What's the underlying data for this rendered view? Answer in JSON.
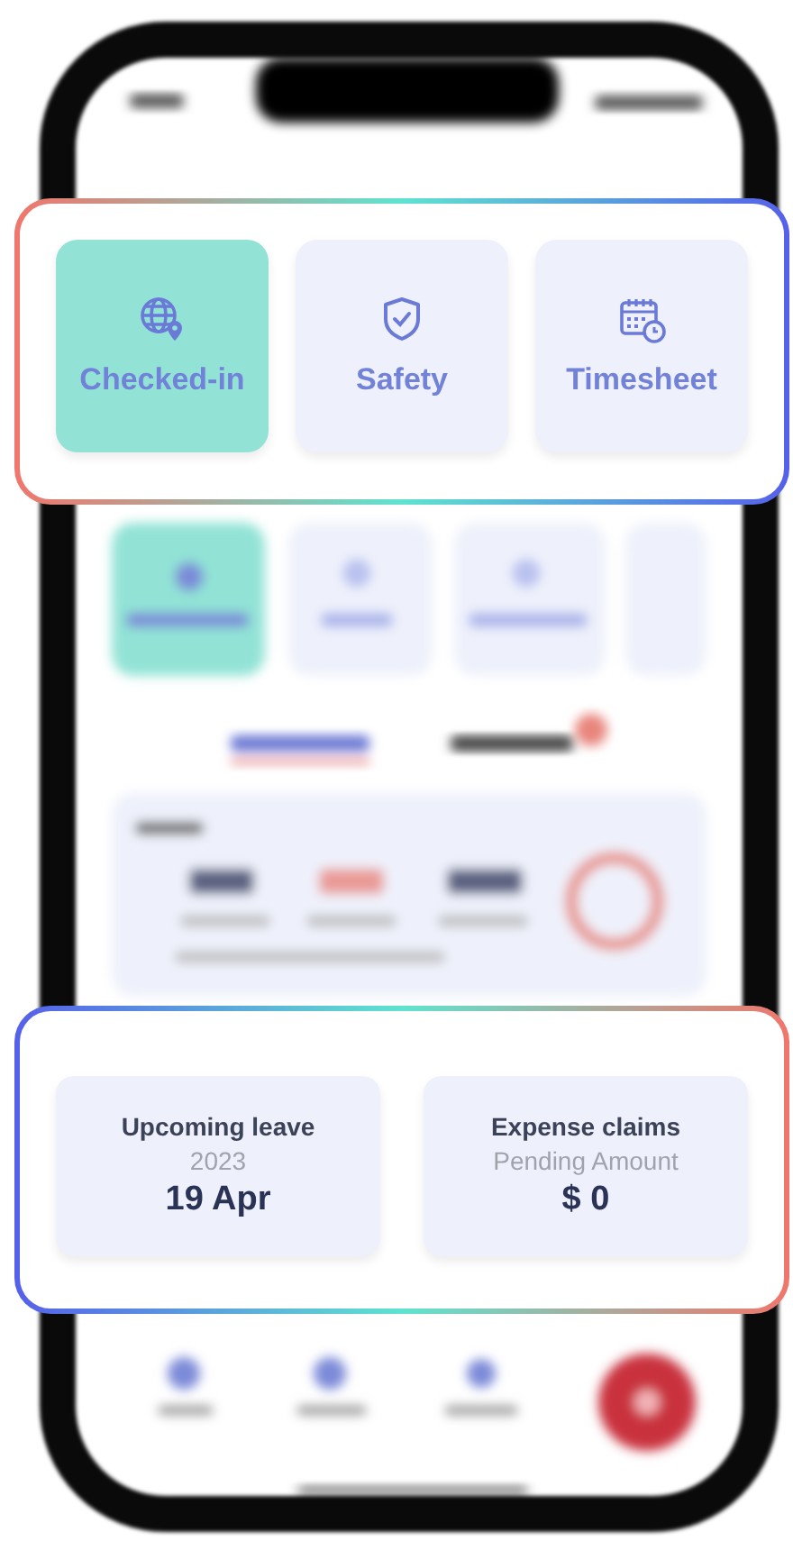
{
  "highlight_top": {
    "tiles": [
      {
        "label": "Checked-in",
        "selected": true
      },
      {
        "label": "Safety",
        "selected": false
      },
      {
        "label": "Timesheet",
        "selected": false
      }
    ]
  },
  "highlight_bottom": {
    "cards": [
      {
        "title": "Upcoming leave",
        "subtitle": "2023",
        "value": "19 Apr"
      },
      {
        "title": "Expense claims",
        "subtitle": "Pending Amount",
        "value": "$ 0"
      }
    ]
  }
}
